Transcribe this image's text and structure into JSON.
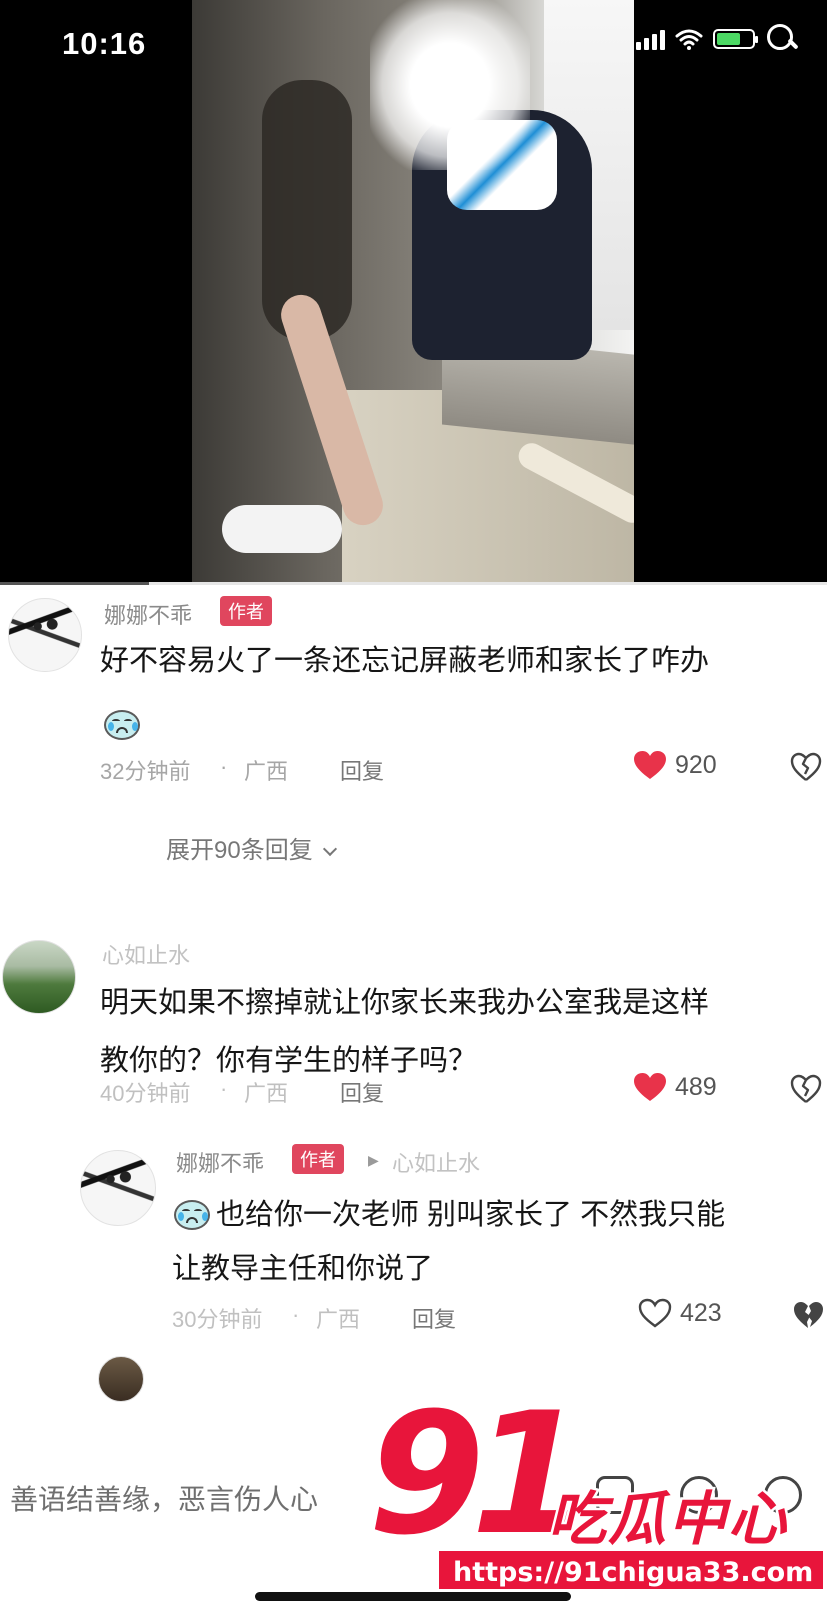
{
  "status_bar": {
    "time": "10:16"
  },
  "video": {
    "progress_fraction": 0.18
  },
  "comments": [
    {
      "author": "娜娜不乖",
      "tag": "作者",
      "text": "好不容易火了一条还忘记屏蔽老师和家长了咋办",
      "emoji": "crying-face-emoji",
      "time": "32分钟前",
      "sep": "·",
      "location": "广西",
      "reply_label": "回复",
      "likes": "920",
      "liked": true,
      "expand_label": "展开90条回复"
    },
    {
      "author": "心如止水",
      "text_line1": "明天如果不擦掉就让你家长来我办公室我是这样",
      "text_line2": "教你的？你有学生的样子吗？",
      "time": "40分钟前",
      "sep": "·",
      "location": "广西",
      "reply_label": "回复",
      "likes": "489",
      "liked": true
    },
    {
      "author": "娜娜不乖",
      "tag": "作者",
      "reply_to": "心如止水",
      "emoji": "crying-face-emoji",
      "text_line1": "也给你一次老师 别叫家长了 不然我只能",
      "text_line2": "让教导主任和你说了",
      "time": "30分钟前",
      "sep": "·",
      "location": "广西",
      "reply_label": "回复",
      "likes": "423",
      "liked": false
    }
  ],
  "input": {
    "placeholder": "善语结善缘，恶言伤人心"
  },
  "watermark": {
    "number": "91",
    "text": "吃瓜中心",
    "url": "https://91chigua33.com"
  },
  "colors": {
    "like_red": "#e8334a",
    "author_tag": "#e0465e",
    "watermark_red": "#e8153b"
  }
}
